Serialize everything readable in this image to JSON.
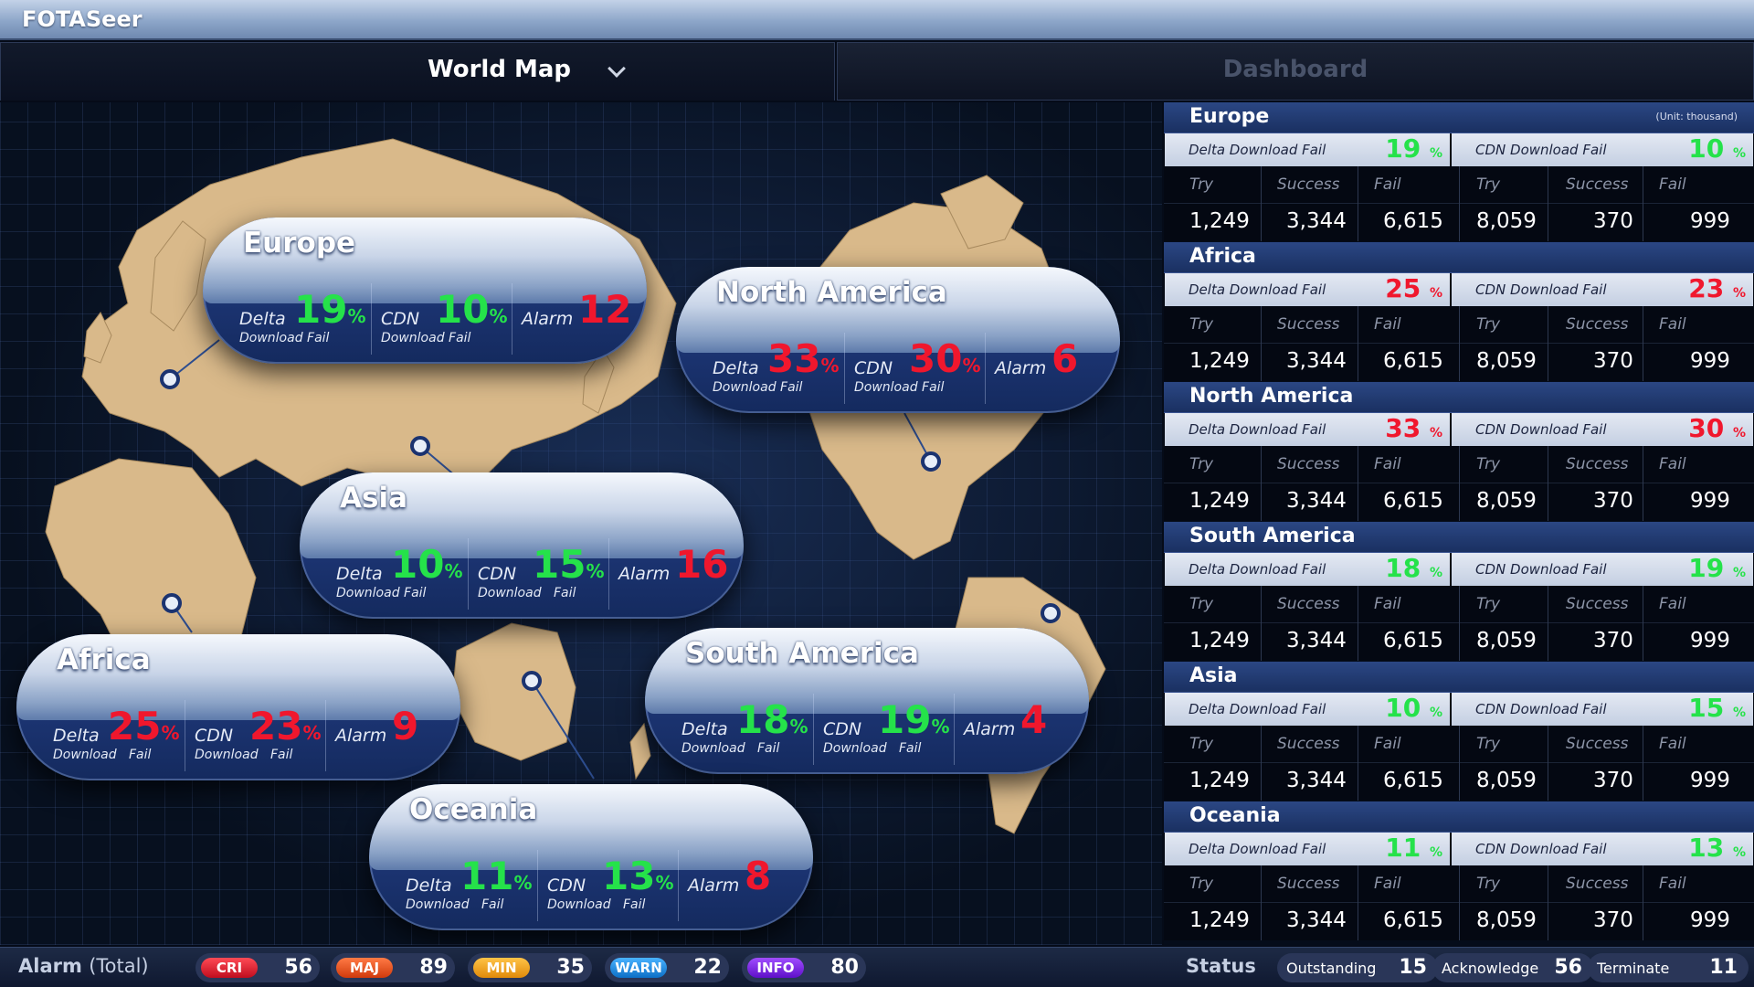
{
  "app_title": "FOTASeer",
  "tabs": {
    "map": "World Map",
    "dashboard": "Dashboard"
  },
  "labels": {
    "delta": "Delta",
    "cdn": "CDN",
    "download_fail": "Download Fail",
    "download": "Download",
    "fail": "Fail",
    "alarm": "Alarm",
    "pct": "%",
    "delta_download_fail": "Delta Download Fail",
    "cdn_download_fail": "CDN Download Fail",
    "try": "Try",
    "success": "Success",
    "unit": "(Unit: thousand)"
  },
  "colors": {
    "good": "#25e24a",
    "bad": "#f0172d",
    "accent": "#1a3061",
    "land": "#d9b98a"
  },
  "regions": [
    {
      "name": "Europe",
      "delta": 19,
      "cdn": 10,
      "alarm": 12,
      "delta_status": "good",
      "cdn_status": "good",
      "delta_table": {
        "try": "1,249",
        "success": "3,344",
        "fail": "6,615"
      },
      "cdn_table": {
        "try": "8,059",
        "success": "370",
        "fail": "999"
      }
    },
    {
      "name": "Africa",
      "delta": 25,
      "cdn": 23,
      "alarm": 9,
      "delta_status": "bad",
      "cdn_status": "bad",
      "delta_table": {
        "try": "1,249",
        "success": "3,344",
        "fail": "6,615"
      },
      "cdn_table": {
        "try": "8,059",
        "success": "370",
        "fail": "999"
      }
    },
    {
      "name": "North America",
      "delta": 33,
      "cdn": 30,
      "alarm": 6,
      "delta_status": "bad",
      "cdn_status": "bad",
      "delta_table": {
        "try": "1,249",
        "success": "3,344",
        "fail": "6,615"
      },
      "cdn_table": {
        "try": "8,059",
        "success": "370",
        "fail": "999"
      }
    },
    {
      "name": "South America",
      "delta": 18,
      "cdn": 19,
      "alarm": 4,
      "delta_status": "good",
      "cdn_status": "good",
      "delta_table": {
        "try": "1,249",
        "success": "3,344",
        "fail": "6,615"
      },
      "cdn_table": {
        "try": "8,059",
        "success": "370",
        "fail": "999"
      }
    },
    {
      "name": "Asia",
      "delta": 10,
      "cdn": 15,
      "alarm": 16,
      "delta_status": "good",
      "cdn_status": "good",
      "delta_table": {
        "try": "1,249",
        "success": "3,344",
        "fail": "6,615"
      },
      "cdn_table": {
        "try": "8,059",
        "success": "370",
        "fail": "999"
      }
    },
    {
      "name": "Oceania",
      "delta": 11,
      "cdn": 13,
      "alarm": 8,
      "delta_status": "good",
      "cdn_status": "good",
      "delta_table": {
        "try": "1,249",
        "success": "3,344",
        "fail": "6,615"
      },
      "cdn_table": {
        "try": "8,059",
        "success": "370",
        "fail": "999"
      }
    }
  ],
  "alarm_total": {
    "title": "Alarm",
    "subtitle": "(Total)",
    "items": [
      {
        "label": "CRI",
        "count": 56,
        "color": "#e0182b"
      },
      {
        "label": "MAJ",
        "count": 89,
        "color": "#f0501a"
      },
      {
        "label": "MIN",
        "count": 35,
        "color": "#f5a21a"
      },
      {
        "label": "WARN",
        "count": 22,
        "color": "#1a8ee0"
      },
      {
        "label": "INFO",
        "count": 80,
        "color": "#7a22e8"
      }
    ]
  },
  "status": {
    "title": "Status",
    "items": [
      {
        "label": "Outstanding",
        "count": 15
      },
      {
        "label": "Acknowledge",
        "count": 56
      },
      {
        "label": "Terminate",
        "count": 11
      }
    ]
  }
}
